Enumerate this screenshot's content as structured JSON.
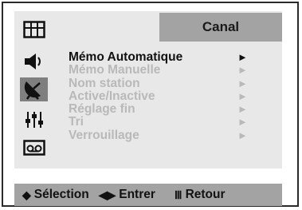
{
  "header": {
    "title": "Canal"
  },
  "sidebar": {
    "icons": [
      {
        "name": "picture-icon"
      },
      {
        "name": "sound-icon"
      },
      {
        "name": "channel-icon",
        "active": true
      },
      {
        "name": "setup-icon"
      },
      {
        "name": "input-icon"
      }
    ]
  },
  "menu": {
    "items": [
      {
        "label": "Mémo Automatique",
        "arrow": "►",
        "active": true
      },
      {
        "label": "Mémo Manuelle",
        "arrow": "►",
        "active": false
      },
      {
        "label": "Nom station",
        "arrow": "►",
        "active": false
      },
      {
        "label": "Active/Inactive",
        "arrow": "►",
        "active": false
      },
      {
        "label": "Réglage fin",
        "arrow": "►",
        "active": false
      },
      {
        "label": "Tri",
        "arrow": "►",
        "active": false
      },
      {
        "label": "Verrouillage",
        "arrow": "►",
        "active": false
      }
    ]
  },
  "footer": {
    "select_glyph": "◆",
    "select_label": "Sélection",
    "enter_glyph": "◀▶",
    "enter_label": "Entrer",
    "return_glyph": "Ⅲ",
    "return_label": "Retour"
  },
  "colors": {
    "panel": "#e8e8e8",
    "header": "#a3a3a3",
    "active_icon_bg": "#7f7f7f",
    "inactive_text": "#b9b9b9",
    "active_text": "#111111"
  }
}
